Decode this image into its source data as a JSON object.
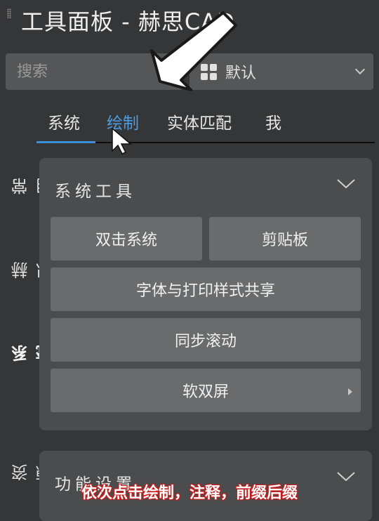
{
  "window": {
    "title": "工具面板 - 赫思CAD"
  },
  "search": {
    "placeholder": "搜索"
  },
  "preset_select": {
    "value": "默认"
  },
  "tabs": [
    {
      "label": "系统"
    },
    {
      "label": "绘制"
    },
    {
      "label": "实体匹配"
    },
    {
      "label": "我"
    }
  ],
  "side_tabs": [
    {
      "label": "常用"
    },
    {
      "label": "赫思"
    },
    {
      "label": "系统工具"
    },
    {
      "label": "资源"
    }
  ],
  "system_tools": {
    "title": "系统工具",
    "buttons": [
      {
        "label": "双击系统"
      },
      {
        "label": "剪贴板"
      },
      {
        "label": "字体与打印样式共享"
      },
      {
        "label": "同步滚动"
      },
      {
        "label": "软双屏"
      }
    ]
  },
  "function_settings": {
    "title": "功能设置"
  },
  "caption": {
    "text": "依次点击绘制，注释，前缀后缀"
  },
  "colors": {
    "accent": "#3b8fd6",
    "caption": "#c81e1e",
    "background": "#353637"
  }
}
